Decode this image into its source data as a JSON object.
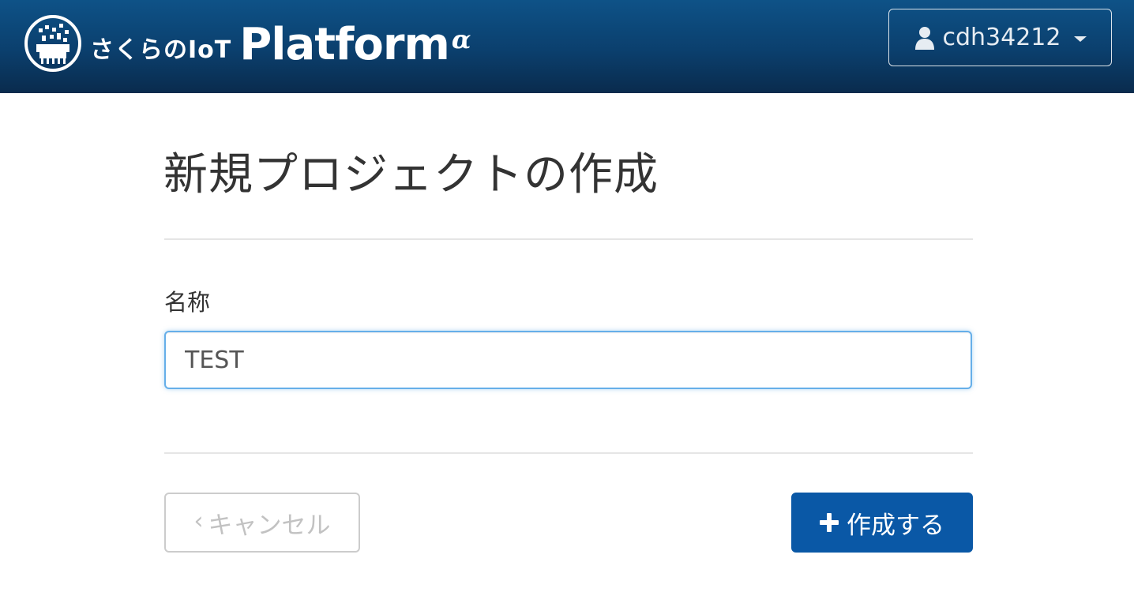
{
  "header": {
    "brand": {
      "sakura_text": "さくらのIoT",
      "platform_text": "Platform",
      "alpha_text": "α",
      "logo_icon": "sakura-iot-logo-icon"
    },
    "user_menu": {
      "username": "cdh34212",
      "icon": "user-icon",
      "caret_icon": "caret-down-icon"
    }
  },
  "main": {
    "title": "新規プロジェクトの作成",
    "form": {
      "name_label": "名称",
      "name_value": "TEST"
    },
    "actions": {
      "cancel_chevron": "‹",
      "cancel_label": "キャンセル",
      "create_label": "作成する",
      "create_icon": "plus-icon"
    }
  },
  "colors": {
    "navbar_top": "#0e5287",
    "navbar_bottom": "#0a2b4d",
    "primary_button": "#0a58a6",
    "input_focus_border": "#66afe9",
    "divider": "#e5e5e5"
  }
}
